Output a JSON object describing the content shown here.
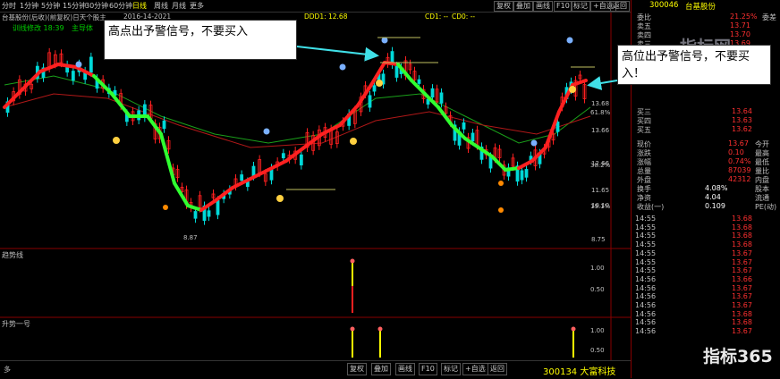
{
  "topbar": {
    "periods": [
      "分时",
      "1分钟",
      "5分钟",
      "15分钟",
      "30分钟",
      "60分钟",
      "日线",
      "周线",
      "月线",
      "更多"
    ],
    "active_period": "日线",
    "buttons": [
      "复权",
      "叠加",
      "画线",
      "F10",
      "标记",
      "+自选",
      "返回"
    ]
  },
  "infobar": {
    "stock_label": "台基股份(后收)(前复权)日天个股主",
    "indicator_label": "DDD1: 12.68",
    "cd_label": "CD1: --",
    "cd2_label": "CD0: --",
    "date_label": "2016-14-2021",
    "badge_1": "训线修改 18:39",
    "badge_2": "主导体"
  },
  "main_chart": {
    "price_labels": [
      "13.68",
      "13.66",
      "12.66",
      "11.65",
      "10.10",
      "8.75"
    ],
    "pct_labels": [
      "61.8%",
      "38.2%",
      "19.1%"
    ],
    "low_label": "8.87"
  },
  "sub_panel_1": {
    "title": "趋势线",
    "scale": [
      "1.00",
      "0.50"
    ]
  },
  "sub_panel_2": {
    "title": "升势一号",
    "scale": [
      "1.00",
      "0.50"
    ]
  },
  "bottombar": {
    "left_label": "多",
    "buttons": [
      "复权",
      "叠加",
      "画线",
      "F10",
      "标记",
      "+自选",
      "返回"
    ],
    "stock_link": "300134 大富科技"
  },
  "right_panel": {
    "code": "300046",
    "name": "台基股份",
    "header_rows": [
      {
        "label": "委比",
        "value": "21.25%",
        "label2": "委差"
      },
      {
        "label": "卖五",
        "value": "13.71",
        "label2": ""
      },
      {
        "label": "卖四",
        "value": "13.70",
        "label2": ""
      },
      {
        "label": "卖三",
        "value": "13.69",
        "label2": ""
      }
    ],
    "buy_rows": [
      {
        "label": "买三",
        "value": "13.64"
      },
      {
        "label": "买四",
        "value": "13.63"
      },
      {
        "label": "买五",
        "value": "13.62"
      }
    ],
    "stats": [
      {
        "l1": "现价",
        "v1": "13.67",
        "l2": "今开"
      },
      {
        "l1": "涨跌",
        "v1": "0.10",
        "l2": "最高"
      },
      {
        "l1": "涨幅",
        "v1": "0.74%",
        "l2": "最低"
      },
      {
        "l1": "总量",
        "v1": "87039",
        "l2": "量比"
      },
      {
        "l1": "外盘",
        "v1": "42312",
        "l2": "内盘"
      },
      {
        "l1": "换手",
        "v1": "4.08%",
        "l2": "股本"
      },
      {
        "l1": "净资",
        "v1": "4.04",
        "l2": "流通"
      },
      {
        "l1": "收益(一)",
        "v1": "0.109",
        "l2": "PE(动)"
      }
    ],
    "ticks": [
      {
        "time": "14:55",
        "price": "13.68"
      },
      {
        "time": "14:55",
        "price": "13.68"
      },
      {
        "time": "14:55",
        "price": "13.68"
      },
      {
        "time": "14:55",
        "price": "13.68"
      },
      {
        "time": "14:55",
        "price": "13.67"
      },
      {
        "time": "14:55",
        "price": "13.67"
      },
      {
        "time": "14:55",
        "price": "13.67"
      },
      {
        "time": "14:56",
        "price": "13.66"
      },
      {
        "time": "14:56",
        "price": "13.67"
      },
      {
        "time": "14:56",
        "price": "13.67"
      },
      {
        "time": "14:56",
        "price": "13.67"
      },
      {
        "time": "14:56",
        "price": "13.68"
      },
      {
        "time": "14:56",
        "price": "13.68"
      },
      {
        "time": "14:56",
        "price": "13.67"
      }
    ]
  },
  "callouts": {
    "left": "高点出予警信号，不要买入",
    "right": "高位出予警信号，不要买入！"
  },
  "watermarks": {
    "top": "指标网",
    "bottom": "指标365"
  },
  "colors": {
    "up": "#ff2020",
    "down": "#00d8d8",
    "green_line": "#30ff30",
    "red_line": "#ff2020",
    "ma_green": "#1aa01a",
    "ma_red": "#b01818",
    "signal": "#ffff00"
  }
}
